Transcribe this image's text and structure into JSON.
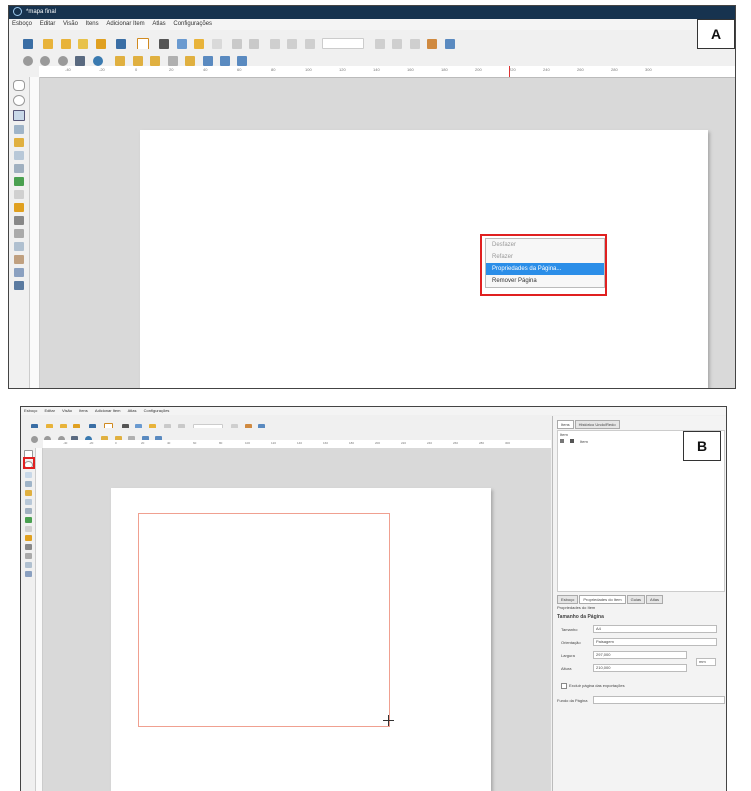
{
  "panelA": {
    "label": "A",
    "window_title": "*mapa final",
    "menu": [
      "Esboço",
      "Editar",
      "Visão",
      "Itens",
      "Adicionar Item",
      "Atlas",
      "Configurações"
    ],
    "ruler_ticks": [
      "-40",
      "-20",
      "0",
      "20",
      "40",
      "60",
      "80",
      "100",
      "120",
      "140",
      "160",
      "180",
      "200",
      "220",
      "240",
      "260",
      "280",
      "300"
    ],
    "context_menu": {
      "undo": "Desfazer",
      "redo": "Refazer",
      "page_properties": "Propriedades da Página...",
      "remove_page": "Remover Página"
    },
    "highlight_color": "#e02020"
  },
  "panelB": {
    "label": "B",
    "menu": [
      "Esboço",
      "Editar",
      "Visão",
      "Itens",
      "Adicionar Item",
      "Atlas",
      "Configurações"
    ],
    "ruler_ticks": [
      "-40",
      "-20",
      "0",
      "20",
      "40",
      "60",
      "80",
      "100",
      "120",
      "140",
      "160",
      "180",
      "200",
      "220",
      "240",
      "260",
      "280",
      "300"
    ],
    "right_panel": {
      "tabs_top": [
        "Itens",
        "Histórico Undo/Redo"
      ],
      "items_header": "Item",
      "items_row": "Item",
      "tabs_bottom": [
        "Esboço",
        "Propriedades do Item",
        "Guias",
        "Atlas"
      ],
      "props_title": "Propriedades do Item",
      "section_title": "Tamanho da Página",
      "size_label": "Tamanho",
      "size_value": "A4",
      "orientation_label": "Orientação",
      "orientation_value": "Paisagem",
      "width_label": "Largura",
      "width_value": "297,000",
      "height_label": "Altura",
      "height_value": "210,000",
      "unit_value": "mm",
      "exclude_label": "Excluir página das exportações",
      "background_label": "Fundo da Página"
    }
  }
}
